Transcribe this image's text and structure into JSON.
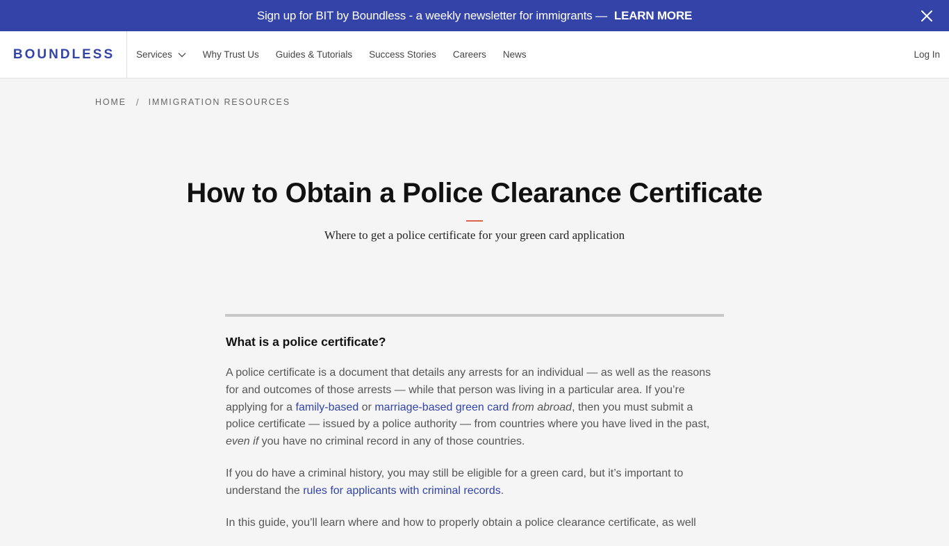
{
  "banner": {
    "text": "Sign up for BIT by Boundless - a weekly newsletter for immigrants —",
    "link": "LEARN MORE",
    "close_icon": "close-icon"
  },
  "nav": {
    "logo": "BOUNDLESS",
    "items": [
      {
        "label": "Services",
        "has_dropdown": true
      },
      {
        "label": "Why Trust Us"
      },
      {
        "label": "Guides & Tutorials"
      },
      {
        "label": "Success Stories"
      },
      {
        "label": "Careers"
      },
      {
        "label": "News"
      }
    ],
    "login": "Log In"
  },
  "breadcrumb": {
    "home": "HOME",
    "separator": "/",
    "current": "IMMIGRATION RESOURCES"
  },
  "article": {
    "title": "How to Obtain a Police Clearance Certificate",
    "subtitle": "Where to get a police certificate for your green card application",
    "section_heading": "What is a police certificate?",
    "p1": {
      "a": "A police certificate is a document that details any arrests for an individual — as well as the reasons for and outcomes of those arrests — while that person was living in a particular area. If you’re applying for a ",
      "link1": "family-based",
      "b": " or ",
      "link2": "marriage-based green card",
      "em1": " from abroad",
      "c": ", then you must submit a police certificate — issued by a police authority — from countries where you have lived in the past, ",
      "em2": "even if",
      "d": " you have no criminal record in any of those countries."
    },
    "p2": {
      "a": "If you do have a criminal history, you may still be eligible for a green card, but it’s important to understand the ",
      "link": "rules for applicants with criminal records",
      "b": "."
    },
    "p3": "In this guide, you’ll learn where and how to properly obtain a police clearance certificate, as well"
  },
  "colors": {
    "brand": "#3343a7",
    "accent": "#e0614b",
    "background": "#f4f5f4"
  }
}
